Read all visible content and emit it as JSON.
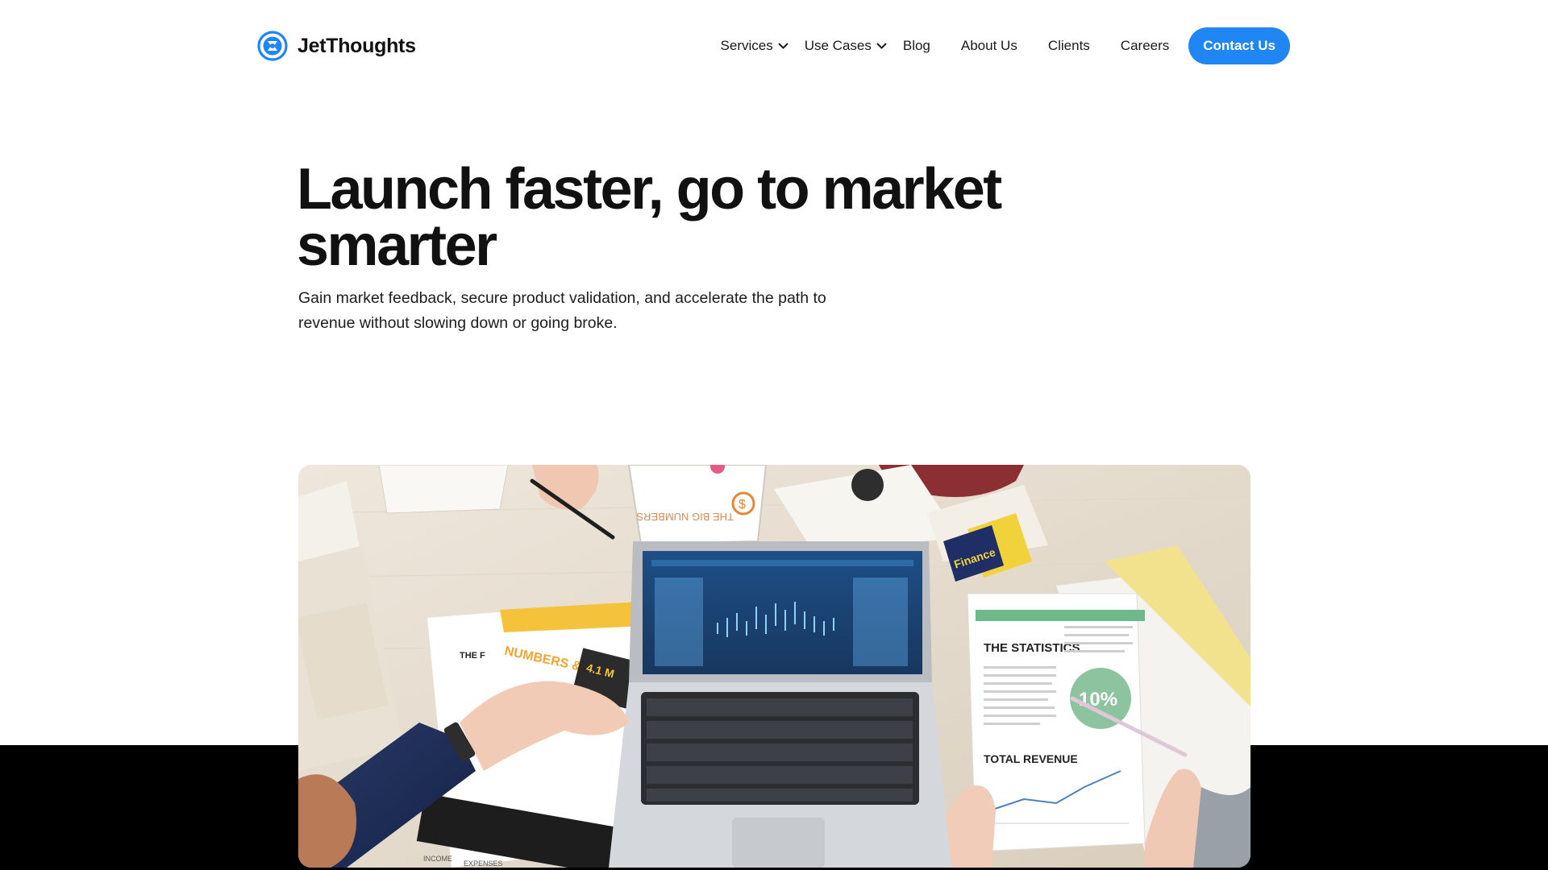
{
  "brand": {
    "name": "JetThoughts",
    "icon": "jetthoughts-logo-icon",
    "accent_color": "#1f86f3"
  },
  "nav": {
    "items": [
      {
        "label": "Services",
        "has_dropdown": true
      },
      {
        "label": "Use Cases",
        "has_dropdown": true
      },
      {
        "label": "Blog",
        "has_dropdown": false
      },
      {
        "label": "About Us",
        "has_dropdown": false
      },
      {
        "label": "Clients",
        "has_dropdown": false
      },
      {
        "label": "Careers",
        "has_dropdown": false
      }
    ],
    "cta_label": "Contact Us"
  },
  "hero": {
    "title_line1": "Launch faster, go to market",
    "title_line2": "smarter",
    "subtitle_line1": "Gain market feedback, secure product validation, and accelerate the path to",
    "subtitle_line2": "revenue without slowing down or going broke."
  },
  "image": {
    "description_icon": "business-desk-photo-icon",
    "printed_text": {
      "statistics": "THE STATISTICS",
      "total_revenue": "TOTAL REVENUE",
      "percent": "10%",
      "numbers": "NUMBERS & STATISTICS",
      "amount": "4.1 M",
      "finance": "Finance",
      "the_f": "THE F",
      "income": "INCOME",
      "expenses": "EXPENSES",
      "big_numbers": "THE BIG NUMBERS",
      "dollar": "$"
    }
  }
}
